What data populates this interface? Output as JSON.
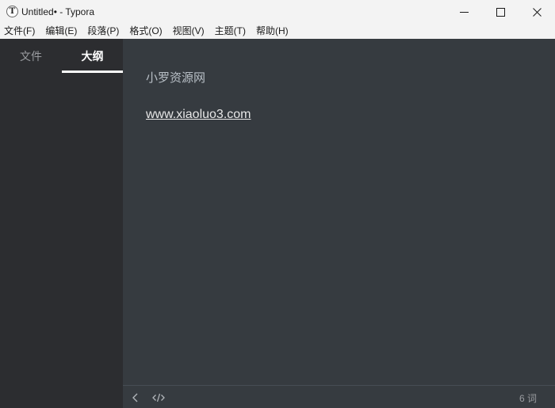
{
  "window": {
    "app_icon_letter": "T",
    "title": "Untitled• - Typora"
  },
  "menu": [
    {
      "label": "文件(F)"
    },
    {
      "label": "编辑(E)"
    },
    {
      "label": "段落(P)"
    },
    {
      "label": "格式(O)"
    },
    {
      "label": "视图(V)"
    },
    {
      "label": "主题(T)"
    },
    {
      "label": "帮助(H)"
    }
  ],
  "sidebar": {
    "tabs": [
      {
        "label": "文件",
        "active": false
      },
      {
        "label": "大纲",
        "active": true
      }
    ]
  },
  "editor": {
    "paragraphs": [
      {
        "text": "小罗资源网"
      },
      {
        "text": "www.xiaoluo3.com",
        "link": true
      }
    ]
  },
  "footer": {
    "word_count": "6 词",
    "icons": [
      "chevron-left-icon",
      "code-icon"
    ]
  },
  "colors": {
    "sidebar_bg": "#2c2d30",
    "editor_bg": "#363b40",
    "titlebar_bg": "#f3f3f3"
  }
}
